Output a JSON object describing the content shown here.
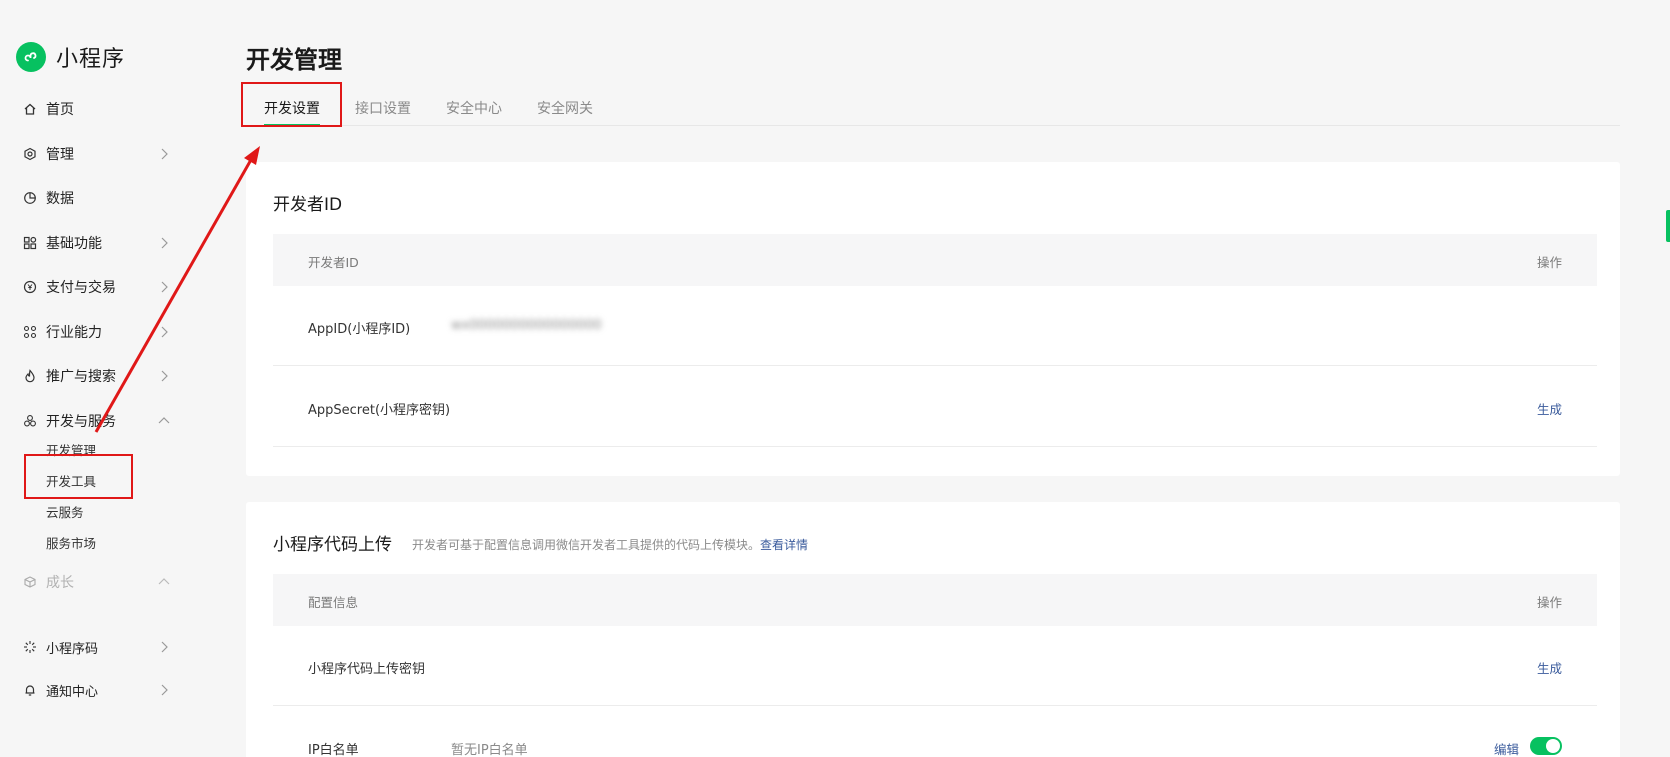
{
  "brand": {
    "name": "小程序",
    "logo_icon": "miniprogram-logo-icon",
    "color": "#07c160"
  },
  "sidebar": {
    "items": [
      {
        "label": "首页",
        "icon": "home-icon"
      },
      {
        "label": "管理",
        "icon": "settings-hex-icon",
        "chevron": "right"
      },
      {
        "label": "数据",
        "icon": "pie-chart-icon"
      },
      {
        "label": "基础功能",
        "icon": "grid-icon",
        "chevron": "right"
      },
      {
        "label": "支付与交易",
        "icon": "yen-icon",
        "chevron": "right"
      },
      {
        "label": "行业能力",
        "icon": "nodes-icon",
        "chevron": "right"
      },
      {
        "label": "推广与搜索",
        "icon": "flame-icon",
        "chevron": "right"
      },
      {
        "label": "开发与服务",
        "icon": "dev-service-icon",
        "chevron": "up"
      },
      {
        "label": "成长",
        "icon": "growth-icon",
        "chevron": "up"
      },
      {
        "label": "小程序码",
        "icon": "qrcode-burst-icon",
        "chevron": "right"
      },
      {
        "label": "通知中心",
        "icon": "bell-icon",
        "chevron": "right"
      }
    ],
    "dev_sub_items": [
      "开发管理",
      "开发工具",
      "云服务",
      "服务市场"
    ]
  },
  "main": {
    "title": "开发管理",
    "tabs": [
      "开发设置",
      "接口设置",
      "安全中心",
      "安全网关"
    ],
    "active_tab": "开发设置"
  },
  "dev_id_card": {
    "title": "开发者ID",
    "header": {
      "col1": "开发者ID",
      "col2": "操作"
    },
    "rows": [
      {
        "key": "AppID(小程序ID)",
        "value": "wx0000000000000000",
        "action": ""
      },
      {
        "key": "AppSecret(小程序密钥)",
        "value": "",
        "action": "生成"
      }
    ]
  },
  "upload_card": {
    "title": "小程序代码上传",
    "desc": "开发者可基于配置信息调用微信开发者工具提供的代码上传模块。",
    "link": "查看详情",
    "header": {
      "col1": "配置信息",
      "col2": "操作"
    },
    "rows": [
      {
        "key": "小程序代码上传密钥",
        "value": "",
        "action": "生成"
      },
      {
        "key": "IP白名单",
        "value": "暂无IP白名单",
        "action": "编辑",
        "toggle": "on"
      }
    ]
  },
  "colors": {
    "accent": "#07c160",
    "link": "#3a5b9c",
    "annotation": "#e01818"
  }
}
